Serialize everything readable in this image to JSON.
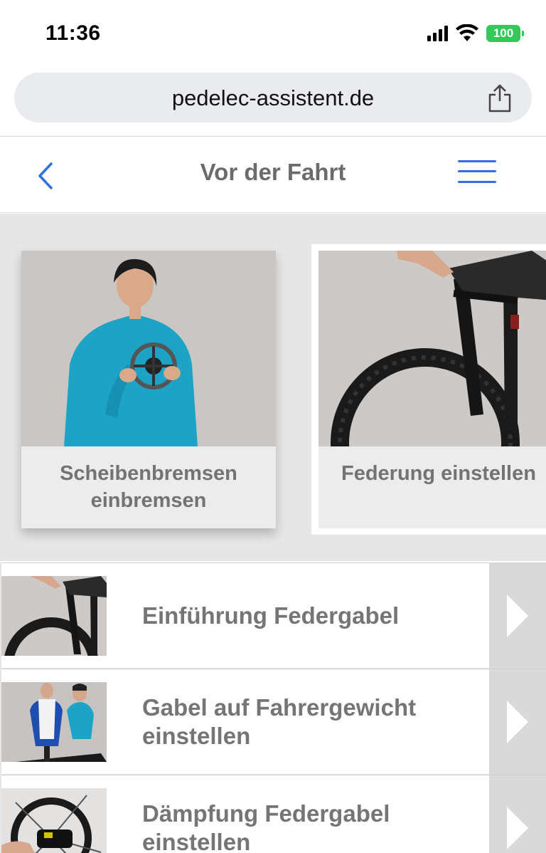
{
  "status_bar": {
    "time": "11:36",
    "battery": "100"
  },
  "browser": {
    "url": "pedelec-assistent.de"
  },
  "header": {
    "title": "Vor der Fahrt"
  },
  "carousel": [
    {
      "label_line1": "Scheibenbremsen",
      "label_line2": "einbremsen"
    },
    {
      "label_line1": "Federung einstellen"
    }
  ],
  "list_items": [
    {
      "title": "Einführung Federgabel"
    },
    {
      "title_line1": "Gabel auf Fahrergewicht",
      "title_line2": "einstellen"
    },
    {
      "title_line1": "Dämpfung Federgabel",
      "title_line2": "einstellen"
    }
  ],
  "colors": {
    "accent": "#2f6fe0",
    "battery": "#34c759",
    "text_gray": "#737373"
  },
  "icons": [
    "signal-icon",
    "wifi-icon",
    "battery-icon",
    "share-icon",
    "back-chevron-icon",
    "hamburger-menu-icon",
    "chevron-right-icon"
  ]
}
